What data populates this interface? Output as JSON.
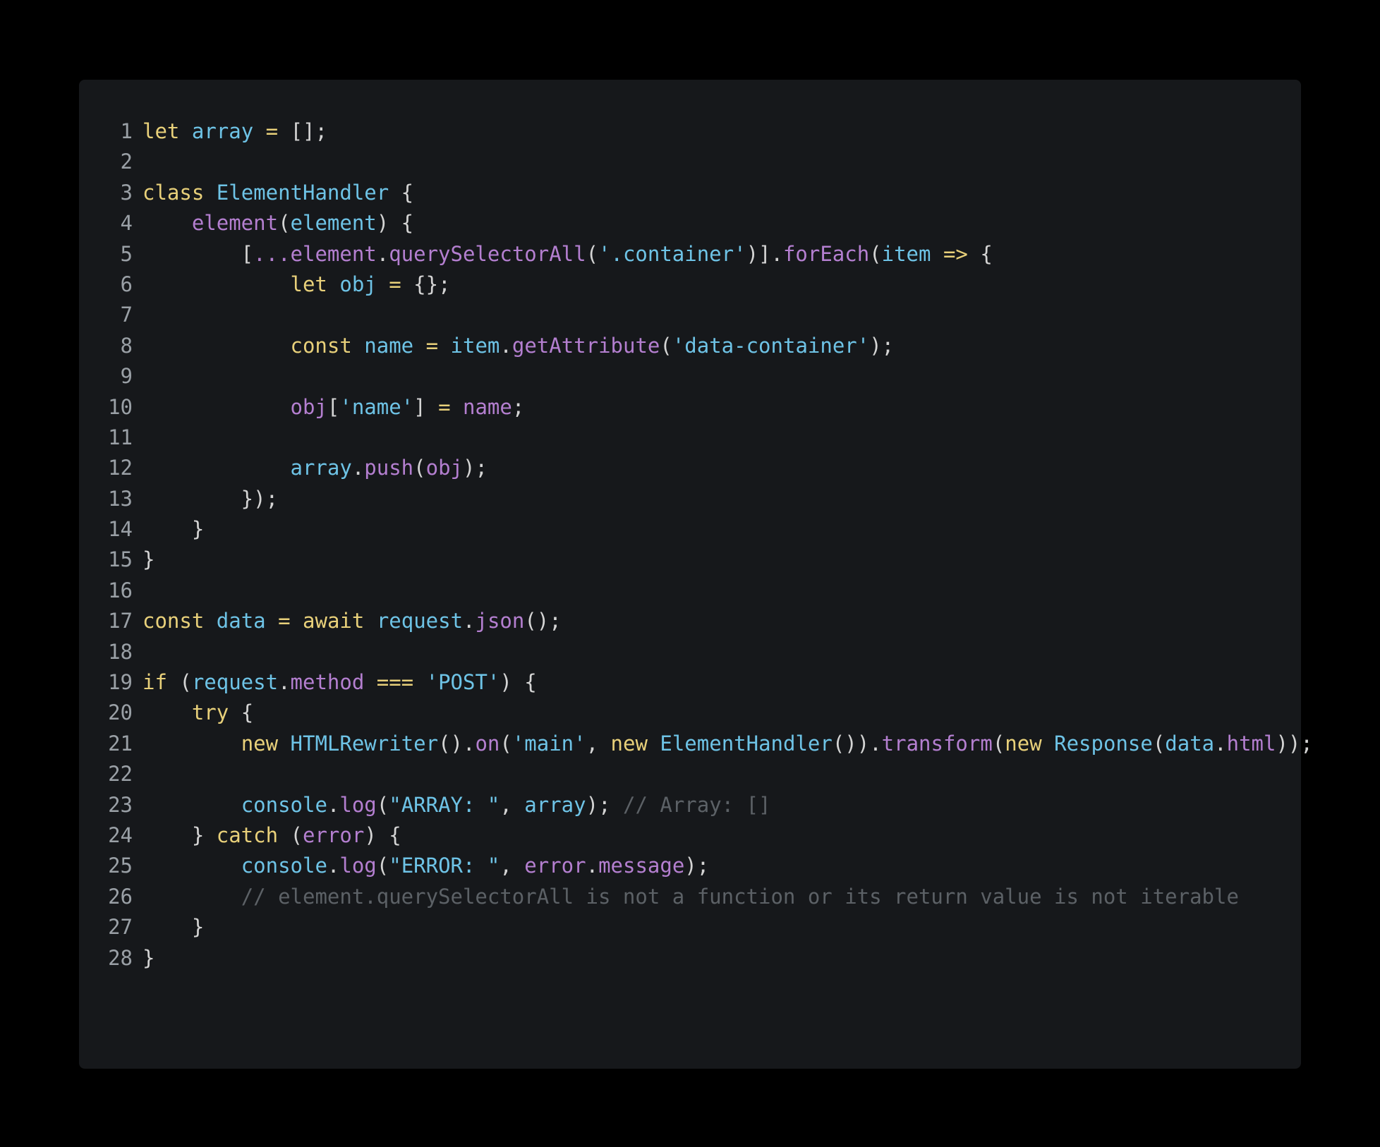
{
  "editor": {
    "lines": [
      {
        "n": "1",
        "tokens": [
          [
            "kw",
            "let"
          ],
          [
            "p",
            " "
          ],
          [
            "var",
            "array"
          ],
          [
            "p",
            " "
          ],
          [
            "op",
            "="
          ],
          [
            "p",
            " [];"
          ]
        ]
      },
      {
        "n": "2",
        "tokens": []
      },
      {
        "n": "3",
        "tokens": [
          [
            "kw",
            "class"
          ],
          [
            "p",
            " "
          ],
          [
            "ty",
            "ElementHandler"
          ],
          [
            "p",
            " {"
          ]
        ]
      },
      {
        "n": "4",
        "tokens": [
          [
            "p",
            "    "
          ],
          [
            "fn",
            "element"
          ],
          [
            "p",
            "("
          ],
          [
            "var",
            "element"
          ],
          [
            "p",
            ") {"
          ]
        ]
      },
      {
        "n": "5",
        "tokens": [
          [
            "p",
            "        ["
          ],
          [
            "fn",
            "..."
          ],
          [
            "fn",
            "element"
          ],
          [
            "p",
            "."
          ],
          [
            "fn",
            "querySelectorAll"
          ],
          [
            "p",
            "("
          ],
          [
            "str",
            "'.container'"
          ],
          [
            "p",
            ")]."
          ],
          [
            "fn",
            "forEach"
          ],
          [
            "p",
            "("
          ],
          [
            "var",
            "item"
          ],
          [
            "p",
            " "
          ],
          [
            "op",
            "=>"
          ],
          [
            "p",
            " {"
          ]
        ]
      },
      {
        "n": "6",
        "tokens": [
          [
            "p",
            "            "
          ],
          [
            "kw",
            "let"
          ],
          [
            "p",
            " "
          ],
          [
            "var",
            "obj"
          ],
          [
            "p",
            " "
          ],
          [
            "op",
            "="
          ],
          [
            "p",
            " {};"
          ]
        ]
      },
      {
        "n": "7",
        "tokens": []
      },
      {
        "n": "8",
        "tokens": [
          [
            "p",
            "            "
          ],
          [
            "kw",
            "const"
          ],
          [
            "p",
            " "
          ],
          [
            "var",
            "name"
          ],
          [
            "p",
            " "
          ],
          [
            "op",
            "="
          ],
          [
            "p",
            " "
          ],
          [
            "var",
            "item"
          ],
          [
            "p",
            "."
          ],
          [
            "fn",
            "getAttribute"
          ],
          [
            "p",
            "("
          ],
          [
            "str",
            "'data-container'"
          ],
          [
            "p",
            ");"
          ]
        ]
      },
      {
        "n": "9",
        "tokens": []
      },
      {
        "n": "10",
        "tokens": [
          [
            "p",
            "            "
          ],
          [
            "fn",
            "obj"
          ],
          [
            "p",
            "["
          ],
          [
            "str",
            "'name'"
          ],
          [
            "p",
            "] "
          ],
          [
            "op",
            "="
          ],
          [
            "p",
            " "
          ],
          [
            "fn",
            "name"
          ],
          [
            "p",
            ";"
          ]
        ]
      },
      {
        "n": "11",
        "tokens": []
      },
      {
        "n": "12",
        "tokens": [
          [
            "p",
            "            "
          ],
          [
            "var",
            "array"
          ],
          [
            "p",
            "."
          ],
          [
            "fn",
            "push"
          ],
          [
            "p",
            "("
          ],
          [
            "fn",
            "obj"
          ],
          [
            "p",
            ");"
          ]
        ]
      },
      {
        "n": "13",
        "tokens": [
          [
            "p",
            "        });"
          ]
        ]
      },
      {
        "n": "14",
        "tokens": [
          [
            "p",
            "    }"
          ]
        ]
      },
      {
        "n": "15",
        "tokens": [
          [
            "p",
            "}"
          ]
        ]
      },
      {
        "n": "16",
        "tokens": []
      },
      {
        "n": "17",
        "tokens": [
          [
            "kw",
            "const"
          ],
          [
            "p",
            " "
          ],
          [
            "var",
            "data"
          ],
          [
            "p",
            " "
          ],
          [
            "op",
            "="
          ],
          [
            "p",
            " "
          ],
          [
            "kw",
            "await"
          ],
          [
            "p",
            " "
          ],
          [
            "var",
            "request"
          ],
          [
            "p",
            "."
          ],
          [
            "fn",
            "json"
          ],
          [
            "p",
            "();"
          ]
        ]
      },
      {
        "n": "18",
        "tokens": []
      },
      {
        "n": "19",
        "tokens": [
          [
            "kw",
            "if"
          ],
          [
            "p",
            " ("
          ],
          [
            "var",
            "request"
          ],
          [
            "p",
            "."
          ],
          [
            "fn",
            "method"
          ],
          [
            "p",
            " "
          ],
          [
            "op",
            "==="
          ],
          [
            "p",
            " "
          ],
          [
            "str",
            "'POST'"
          ],
          [
            "p",
            ") {"
          ]
        ]
      },
      {
        "n": "20",
        "tokens": [
          [
            "p",
            "    "
          ],
          [
            "kw",
            "try"
          ],
          [
            "p",
            " {"
          ]
        ]
      },
      {
        "n": "21",
        "tokens": [
          [
            "p",
            "        "
          ],
          [
            "kw",
            "new"
          ],
          [
            "p",
            " "
          ],
          [
            "ty",
            "HTMLRewriter"
          ],
          [
            "p",
            "()."
          ],
          [
            "fn",
            "on"
          ],
          [
            "p",
            "("
          ],
          [
            "str",
            "'main'"
          ],
          [
            "p",
            ", "
          ],
          [
            "kw",
            "new"
          ],
          [
            "p",
            " "
          ],
          [
            "ty",
            "ElementHandler"
          ],
          [
            "p",
            "())."
          ],
          [
            "fn",
            "transform"
          ],
          [
            "p",
            "("
          ],
          [
            "kw",
            "new"
          ],
          [
            "p",
            " "
          ],
          [
            "ty",
            "Response"
          ],
          [
            "p",
            "("
          ],
          [
            "var",
            "data"
          ],
          [
            "p",
            "."
          ],
          [
            "fn",
            "html"
          ],
          [
            "p",
            "));"
          ]
        ]
      },
      {
        "n": "22",
        "tokens": []
      },
      {
        "n": "23",
        "tokens": [
          [
            "p",
            "        "
          ],
          [
            "var",
            "console"
          ],
          [
            "p",
            "."
          ],
          [
            "fn",
            "log"
          ],
          [
            "p",
            "("
          ],
          [
            "str",
            "\"ARRAY: \""
          ],
          [
            "p",
            ", "
          ],
          [
            "var",
            "array"
          ],
          [
            "p",
            "); "
          ],
          [
            "cm",
            "// Array: []"
          ]
        ]
      },
      {
        "n": "24",
        "tokens": [
          [
            "p",
            "    } "
          ],
          [
            "kw",
            "catch"
          ],
          [
            "p",
            " ("
          ],
          [
            "fn",
            "error"
          ],
          [
            "p",
            ") {"
          ]
        ]
      },
      {
        "n": "25",
        "tokens": [
          [
            "p",
            "        "
          ],
          [
            "var",
            "console"
          ],
          [
            "p",
            "."
          ],
          [
            "fn",
            "log"
          ],
          [
            "p",
            "("
          ],
          [
            "str",
            "\"ERROR: \""
          ],
          [
            "p",
            ", "
          ],
          [
            "fn",
            "error"
          ],
          [
            "p",
            "."
          ],
          [
            "fn",
            "message"
          ],
          [
            "p",
            ");"
          ]
        ]
      },
      {
        "n": "26",
        "tokens": [
          [
            "p",
            "        "
          ],
          [
            "cm",
            "// element.querySelectorAll is not a function or its return value is not iterable"
          ]
        ]
      },
      {
        "n": "27",
        "tokens": [
          [
            "p",
            "    }"
          ]
        ]
      },
      {
        "n": "28",
        "tokens": [
          [
            "p",
            "}"
          ]
        ]
      }
    ]
  }
}
